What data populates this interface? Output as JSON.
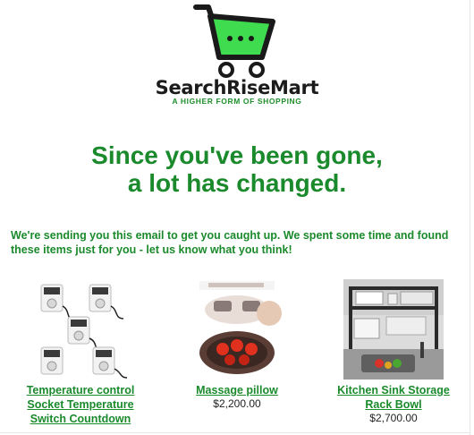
{
  "brand": {
    "name": "SearchRiseMart",
    "tagline": "A HIGHER FORM OF SHOPPING",
    "accent": "#1b8a2c",
    "logo_green": "#3fdc4f"
  },
  "headline": {
    "line1": "Since you've been gone,",
    "line2": "a lot has changed."
  },
  "intro": "We're sending you this email to get you caught up. We spent some time and found these items just for you - let us know what you think!",
  "products": [
    {
      "name": "Temperature control Socket Temperature Switch Countdown",
      "price": "",
      "image": "thermostat-sockets-image"
    },
    {
      "name": "Massage pillow",
      "price": "$2,200.00",
      "image": "massage-pillow-image"
    },
    {
      "name": "Kitchen Sink Storage Rack Bowl",
      "price": "$2,700.00",
      "image": "sink-rack-image"
    }
  ]
}
